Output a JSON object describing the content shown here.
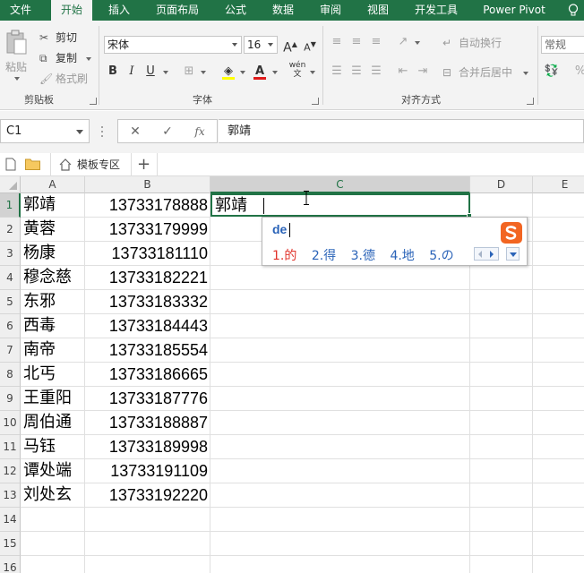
{
  "ribbon_tabs": [
    "文件",
    "开始",
    "插入",
    "页面布局",
    "公式",
    "数据",
    "审阅",
    "视图",
    "开发工具",
    "Power Pivot"
  ],
  "active_tab": "开始",
  "clipboard": {
    "paste": "粘贴",
    "cut": "剪切",
    "copy": "复制",
    "format_painter": "格式刷",
    "group_label": "剪贴板"
  },
  "font": {
    "name": "宋体",
    "size": "16",
    "bold": "B",
    "italic": "I",
    "underline": "U",
    "wen": "wén",
    "group_label": "字体"
  },
  "alignment": {
    "wrap": "自动换行",
    "merge": "合并后居中",
    "group_label": "对齐方式"
  },
  "number": {
    "format": "常规"
  },
  "formula_bar": {
    "name_box": "C1",
    "cancel": "✕",
    "enter": "✓",
    "fx": "fx",
    "value": "郭靖"
  },
  "quick_bar": {
    "template_tab": "模板专区",
    "add": "+"
  },
  "columns": [
    "A",
    "B",
    "C",
    "D",
    "E"
  ],
  "rows": [
    {
      "num": "1",
      "name": "郭靖",
      "phone": "13733178888",
      "c": "郭靖"
    },
    {
      "num": "2",
      "name": "黄蓉",
      "phone": "13733179999"
    },
    {
      "num": "3",
      "name": "杨康",
      "phone": "13733181110"
    },
    {
      "num": "4",
      "name": "穆念慈",
      "phone": "13733182221"
    },
    {
      "num": "5",
      "name": "东邪",
      "phone": "13733183332"
    },
    {
      "num": "6",
      "name": "西毒",
      "phone": "13733184443"
    },
    {
      "num": "7",
      "name": "南帝",
      "phone": "13733185554"
    },
    {
      "num": "8",
      "name": "北丐",
      "phone": "13733186665"
    },
    {
      "num": "9",
      "name": "王重阳",
      "phone": "13733187776"
    },
    {
      "num": "10",
      "name": "周伯通",
      "phone": "13733188887"
    },
    {
      "num": "11",
      "name": "马钰",
      "phone": "13733189998"
    },
    {
      "num": "12",
      "name": "谭处端",
      "phone": "13733191109"
    },
    {
      "num": "13",
      "name": "刘处玄",
      "phone": "13733192220"
    },
    {
      "num": "14"
    },
    {
      "num": "15"
    },
    {
      "num": "16"
    }
  ],
  "ime": {
    "composition": "de",
    "candidates": [
      "1.的",
      "2.得",
      "3.德",
      "4.地",
      "5.の"
    ]
  },
  "colors": {
    "excel_green": "#217346",
    "ime_blue": "#2a63b8",
    "ime_red": "#e0332b",
    "sogou_orange": "#f26522"
  }
}
